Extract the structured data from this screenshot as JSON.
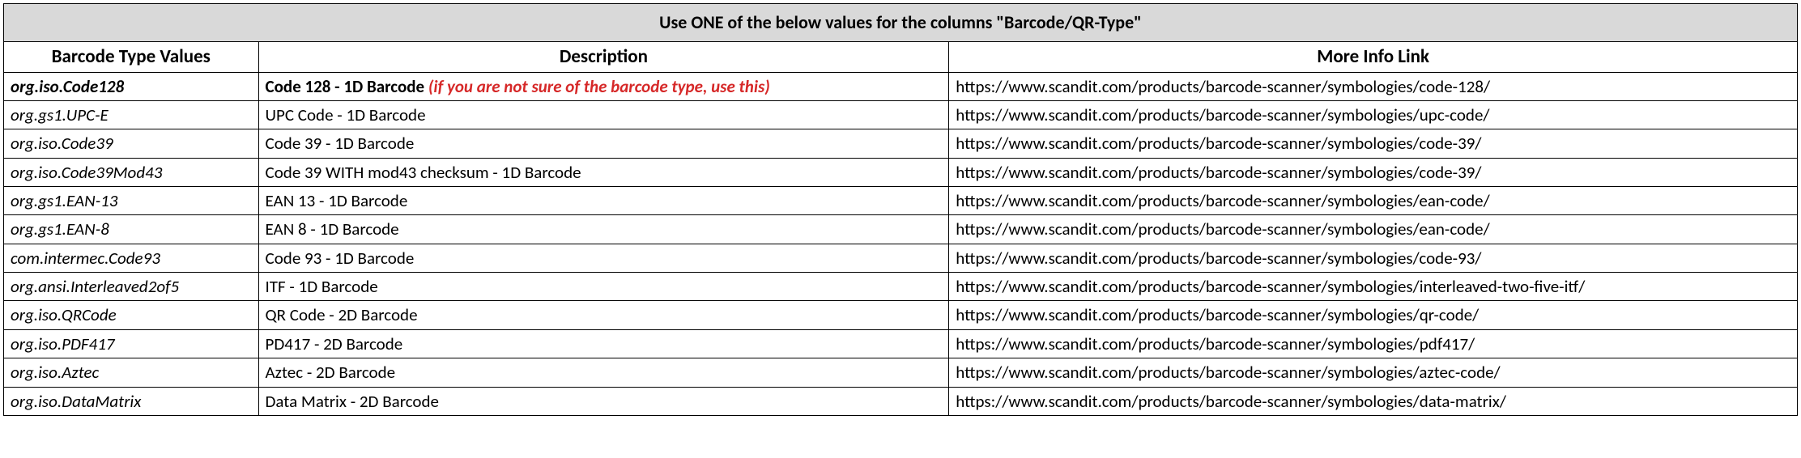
{
  "title": "Use ONE of the below values for the columns \"Barcode/QR-Type\"",
  "headers": {
    "type": "Barcode Type Values",
    "desc": "Description",
    "link": "More Info Link"
  },
  "hint": "(if you are not sure of the barcode type, use this)",
  "rows": [
    {
      "type": "org.iso.Code128",
      "desc": "Code 128 - 1D Barcode ",
      "link": "https://www.scandit.com/products/barcode-scanner/symbologies/code-128/",
      "bold": true,
      "hasHint": true
    },
    {
      "type": "org.gs1.UPC-E",
      "desc": "UPC Code - 1D Barcode",
      "link": "https://www.scandit.com/products/barcode-scanner/symbologies/upc-code/"
    },
    {
      "type": "org.iso.Code39",
      "desc": "Code 39 - 1D Barcode",
      "link": "https://www.scandit.com/products/barcode-scanner/symbologies/code-39/"
    },
    {
      "type": "org.iso.Code39Mod43",
      "desc": "Code 39 WITH mod43 checksum - 1D Barcode",
      "link": "https://www.scandit.com/products/barcode-scanner/symbologies/code-39/"
    },
    {
      "type": "org.gs1.EAN-13",
      "desc": "EAN 13 - 1D Barcode",
      "link": "https://www.scandit.com/products/barcode-scanner/symbologies/ean-code/"
    },
    {
      "type": "org.gs1.EAN-8",
      "desc": "EAN 8 - 1D Barcode",
      "link": "https://www.scandit.com/products/barcode-scanner/symbologies/ean-code/"
    },
    {
      "type": "com.intermec.Code93",
      "desc": "Code 93 - 1D Barcode",
      "link": "https://www.scandit.com/products/barcode-scanner/symbologies/code-93/"
    },
    {
      "type": "org.ansi.Interleaved2of5",
      "desc": "ITF - 1D Barcode",
      "link": "https://www.scandit.com/products/barcode-scanner/symbologies/interleaved-two-five-itf/"
    },
    {
      "type": "org.iso.QRCode",
      "desc": "QR Code - 2D Barcode",
      "link": "https://www.scandit.com/products/barcode-scanner/symbologies/qr-code/"
    },
    {
      "type": "org.iso.PDF417",
      "desc": "PD417 - 2D Barcode",
      "link": "https://www.scandit.com/products/barcode-scanner/symbologies/pdf417/"
    },
    {
      "type": "org.iso.Aztec",
      "desc": "Aztec - 2D Barcode",
      "link": "https://www.scandit.com/products/barcode-scanner/symbologies/aztec-code/"
    },
    {
      "type": "org.iso.DataMatrix",
      "desc": "Data Matrix - 2D Barcode",
      "link": "https://www.scandit.com/products/barcode-scanner/symbologies/data-matrix/"
    }
  ]
}
